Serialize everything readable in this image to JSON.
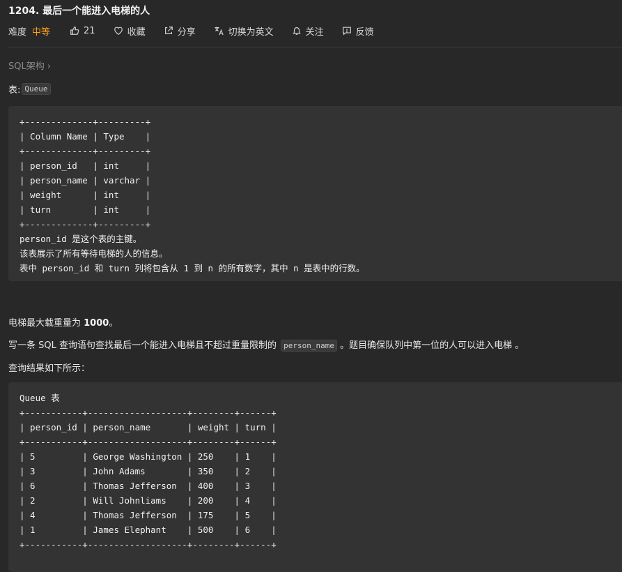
{
  "problem": {
    "title": "1204. 最后一个能进入电梯的人",
    "difficulty_label": "难度",
    "difficulty": "中等",
    "likes": "21",
    "favorite_label": "收藏",
    "share_label": "分享",
    "switch_lang_label": "切换为英文",
    "follow_label": "关注",
    "feedback_label": "反馈"
  },
  "tag": "SQL架构 ›",
  "table_intro": {
    "prefix": "表: ",
    "name": "Queue"
  },
  "schema_block": "+-------------+---------+\n| Column Name | Type    |\n+-------------+---------+\n| person_id   | int     |\n| person_name | varchar |\n| weight      | int     |\n| turn        | int     |\n+-------------+---------+\nperson_id 是这个表的主键。\n该表展示了所有等待电梯的人的信息。\n表中 person_id 和 turn 列将包含从 1 到 n 的所有数字，其中 n 是表中的行数。",
  "paragraph1": {
    "text": "电梯最大载重量为 ",
    "bold": "1000",
    "suffix": "。"
  },
  "paragraph2": {
    "text": "写一条 SQL 查询语句查找最后一个能进入电梯且不超过重量限制的 ",
    "code": "person_name",
    "suffix": " 。题目确保队列中第一位的人可以进入电梯 。"
  },
  "paragraph3": "查询结果如下所示：",
  "example_block": "Queue 表\n+-----------+-------------------+--------+------+\n| person_id | person_name       | weight | turn |\n+-----------+-------------------+--------+------+\n| 5         | George Washington | 250    | 1    |\n| 3         | John Adams        | 350    | 2    |\n| 6         | Thomas Jefferson  | 400    | 3    |\n| 2         | Will Johnliams    | 200    | 4    |\n| 4         | Thomas Jefferson  | 175    | 5    |\n| 1         | James Elephant    | 500    | 6    |\n+-----------+-------------------+--------+------+",
  "colors": {
    "accent": "#ffa116",
    "background": "#282828",
    "code_bg": "#333333"
  },
  "icons": [
    "thumbs-up-icon",
    "heart-icon",
    "share-icon",
    "translate-icon",
    "bell-icon",
    "feedback-icon"
  ]
}
